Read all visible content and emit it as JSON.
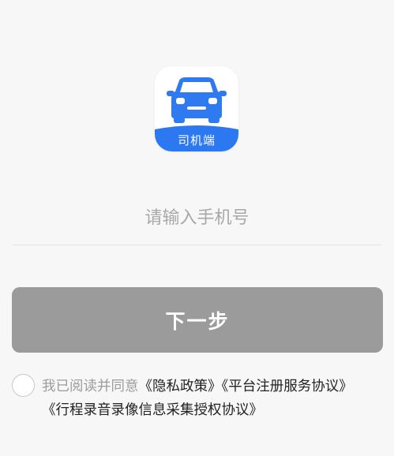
{
  "app_icon": {
    "badge_label": "司机端",
    "icon": "car-icon",
    "colors": {
      "car": "#2f7af1",
      "badge": "#2b78f0",
      "background": "#ffffff"
    }
  },
  "login": {
    "phone_placeholder": "请输入手机号",
    "next_label": "下一步",
    "next_button_color": "#9b9b9b"
  },
  "agreement": {
    "prefix": "我已阅读并同意",
    "privacy_policy": "《隐私政策》",
    "registration_agreement": "《平台注册服务协议》",
    "recording_agreement": "《行程录音录像信息采集授权协议》",
    "checked": false
  }
}
